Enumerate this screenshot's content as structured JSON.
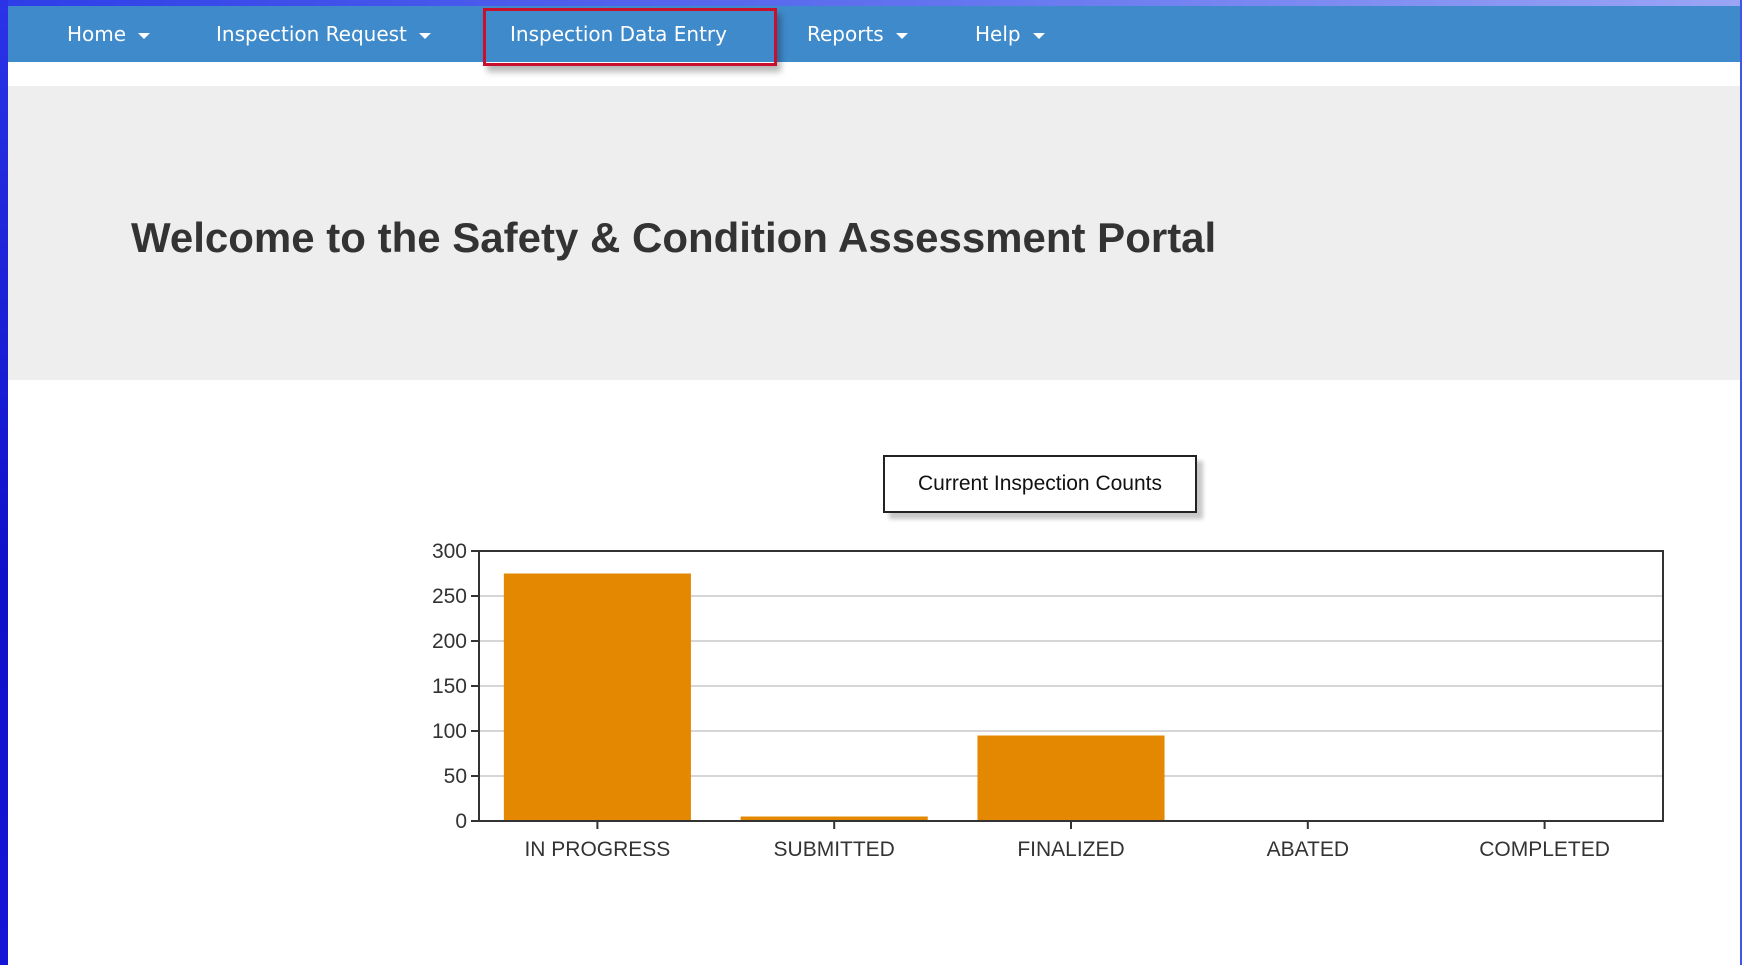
{
  "nav": {
    "items": [
      {
        "label": "Home",
        "dropdown": true
      },
      {
        "label": "Inspection Request",
        "dropdown": true
      },
      {
        "label": "Inspection Data Entry",
        "dropdown": false,
        "highlighted": true
      },
      {
        "label": "Reports",
        "dropdown": true
      },
      {
        "label": "Help",
        "dropdown": true
      }
    ]
  },
  "header": {
    "title": "Welcome to the Safety & Condition Assessment Portal"
  },
  "colors": {
    "navbar": "#3f8acb",
    "highlight": "#c8102e",
    "bar": "#e38800",
    "jumbotron": "#eeeeee"
  },
  "chart_data": {
    "type": "bar",
    "title": "Current Inspection Counts",
    "categories": [
      "IN PROGRESS",
      "SUBMITTED",
      "FINALIZED",
      "ABATED",
      "COMPLETED"
    ],
    "values": [
      275,
      5,
      95,
      0,
      0
    ],
    "xlabel": "",
    "ylabel": "",
    "ylim": [
      0,
      300
    ],
    "yticks": [
      0,
      50,
      100,
      150,
      200,
      250,
      300
    ],
    "grid": true,
    "bar_color": "#e38800"
  }
}
